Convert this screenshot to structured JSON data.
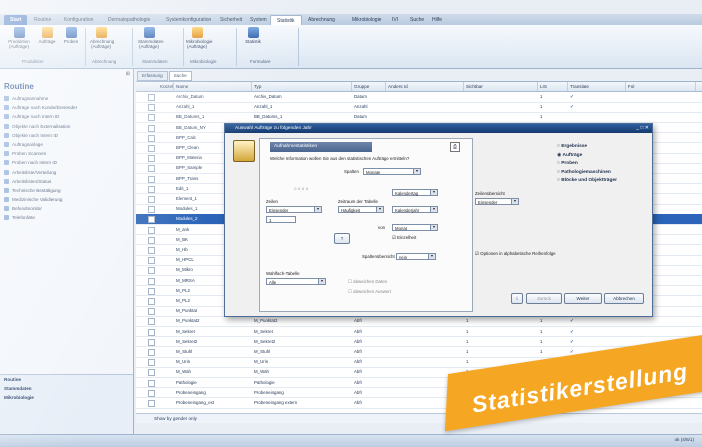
{
  "ribbon_tabs": [
    "Start",
    "Routine",
    "Konfiguration",
    "Dermatopathologie",
    "Systemkonfiguration",
    "Sicherheit",
    "System",
    "Statistik",
    "Abrechnung",
    "Mikrobiologie",
    "IVI",
    "Suche",
    "Hilfe"
  ],
  "ribbon_buttons": [
    {
      "label": "Produktion\n(Aufträge)"
    },
    {
      "label": "Aufträge"
    },
    {
      "label": "Proben"
    },
    {
      "label": "Abrechnung\n(Aufträge)"
    },
    {
      "label": "Stammdaten\n(Aufträge)"
    },
    {
      "label": "Mikrobiologie\n(Aufträge)"
    },
    {
      "label": "Statistik"
    }
  ],
  "ribbon_groups": [
    "Produktion",
    "Abrechnung",
    "Stammdaten",
    "Mikrobiologie",
    "Formulare"
  ],
  "leftpane": {
    "title": "Routine",
    "items": [
      "Auftragsannahme",
      "Aufträge nach Kunde/Einsender",
      "Aufträge nach Intern ID",
      "Objekte nach Externalisation",
      "Objekte nach Intern ID",
      "Auftragsanlage",
      "Proben Scannen",
      "Proben nach Intern ID",
      "Arbeitsliste/Verteilung",
      "Arbeitslisten/Status",
      "Technische Bestätigung",
      "Medizinische Validierung",
      "Befundmonitor",
      "Telefonliste"
    ],
    "footer": [
      "Routine",
      "Stammdaten",
      "Mikrobiologie"
    ]
  },
  "doc_tabs": [
    "Erfassung",
    "Suche"
  ],
  "grid": {
    "columns": [
      "Kürzel",
      "Name",
      "Typ",
      "Gruppe",
      "Anders Id",
      "Sichtbar",
      "LIS",
      "Translate",
      "Fol"
    ],
    "rows": [
      [
        "Archiv_Datum",
        "Archiv_Datum",
        "Datum",
        "",
        "1",
        "✓"
      ],
      [
        "Anzahl_1",
        "Anzahl_1",
        "Anzahl",
        "",
        "1",
        "✓"
      ],
      [
        "BB_Datums_1",
        "BB_Datums_1",
        "Datum",
        "",
        "1",
        ""
      ],
      [
        "BB_Datum_NY",
        "BB_Datum_NY",
        "Datum",
        "",
        "1",
        ""
      ],
      [
        "BPP_Calc",
        "BPP_Calc",
        "Auswahl",
        "",
        "1",
        ""
      ],
      [
        "BPP_Clean",
        "BPP_Clean",
        "Auswahl",
        "",
        "1",
        ""
      ],
      [
        "BPP_Materia",
        "BPP_Materia",
        "Auswahl",
        "",
        "1",
        ""
      ],
      [
        "BPP_Sample",
        "BPP_Sample",
        "Auswahl",
        "",
        "1",
        ""
      ],
      [
        "BPP_Trans",
        "BPP_Trans",
        "Auswahl",
        "",
        "1",
        ""
      ],
      [
        "Edit_1",
        "Edit_1",
        "Text",
        "",
        "1",
        ""
      ],
      [
        "Element_1",
        "Element_1",
        "Text",
        "",
        "1",
        ""
      ],
      [
        "Modules_1",
        "Modules_1",
        "Text",
        "",
        "1",
        ""
      ],
      [
        "Modules_2",
        "Modules_2",
        "Text",
        "",
        "1",
        ""
      ],
      [
        "M_ank",
        "M_ank",
        "Abfr",
        "",
        "1",
        ""
      ],
      [
        "M_BK",
        "M_BK",
        "Abfr",
        "",
        "1",
        ""
      ],
      [
        "M_Hb",
        "M_Hb",
        "Abfr",
        "",
        "1",
        ""
      ],
      [
        "M_HPCL",
        "M_HPCL",
        "Abfr",
        "",
        "1",
        ""
      ],
      [
        "M_Mikro",
        "M_Mikro",
        "Abfr",
        "",
        "1",
        ""
      ],
      [
        "M_MRSA",
        "M_MRSA",
        "Abfr",
        "",
        "1",
        ""
      ],
      [
        "M_PL2",
        "M_PL2",
        "Abfr",
        "",
        "1",
        ""
      ],
      [
        "M_PL2",
        "M_PL2",
        "Abfr",
        "1",
        "1",
        "✓"
      ],
      [
        "M_Punktat",
        "M_Punktat",
        "Abfr",
        "1",
        "1",
        "✓"
      ],
      [
        "M_Punktat2",
        "M_Punktat2",
        "Abfr",
        "1",
        "1",
        "✓"
      ],
      [
        "M_Sekret",
        "M_Sekret",
        "Abfr",
        "1",
        "1",
        "✓"
      ],
      [
        "M_Sekret2",
        "M_Sekret2",
        "Abfr",
        "1",
        "1",
        "✓"
      ],
      [
        "M_Stuhl",
        "M_Stuhl",
        "Abfr",
        "1",
        "1",
        "✓"
      ],
      [
        "M_Urin",
        "M_Urin",
        "Abfr",
        "1",
        "1",
        "✓"
      ],
      [
        "M_Wah",
        "M_Wah",
        "Abfr",
        "1",
        "1",
        "✓"
      ],
      [
        "Pathologie",
        "Pathologie",
        "Abfr",
        "1",
        "1",
        "✓"
      ],
      [
        "Probeneingang",
        "Probeneingang",
        "Abfr",
        "1",
        "1",
        "✓"
      ],
      [
        "Probeneingang_ext",
        "Probeneingang extern",
        "Abfr",
        "1",
        "1",
        "✓"
      ]
    ],
    "selected_row": 12
  },
  "grid_footer": "Show by gender only",
  "status_right": "ok (4/6/1)",
  "dialog": {
    "title": "Auswahl Aufträge zu folgenden Jahr",
    "header": "Aufnahmestatistiken",
    "question": "Welche Information wollen Sie aus den statistischen Aufträge ermitteln?",
    "spalten_label": "Spalten",
    "spalten_value": "Monate",
    "zeilen_label": "Zeilen",
    "zeilen_value": "Einsender",
    "zeilen_cb": "1",
    "zeitraum_label": "Zeitraum der Tabelle",
    "zeitraum_value": "Häufigkeit",
    "zeitraum_value2": "Kalenderjahr",
    "zeitraum_value3": "Kalendertag",
    "von_label": "von",
    "von_value": "Monat",
    "einzelbox": "Einzelheit",
    "zielgruppe_label": "Zeilenübersicht",
    "zielgruppe_value": "Einsender",
    "spalten2_label": "Spaltenübersicht",
    "spalten2_value": "nein",
    "option_label": "Optionen in alphabetische Reihenfolge",
    "wahl_label": "Wahlfach-Tabelle",
    "wahl_value": "Alle",
    "abw_a": "abweichen Daten",
    "abw_b": "abweichen Auswert",
    "btn_back": "Zurück",
    "btn_next": "Weiter",
    "btn_cancel": "Abbrechen",
    "radios": [
      "Ergebnisse",
      "Aufträge",
      "Proben",
      "Pathologiemaschinen",
      "Blöcke und Objektträger"
    ],
    "radio_selected": 1
  },
  "promo_text": "Statistikerstellung"
}
